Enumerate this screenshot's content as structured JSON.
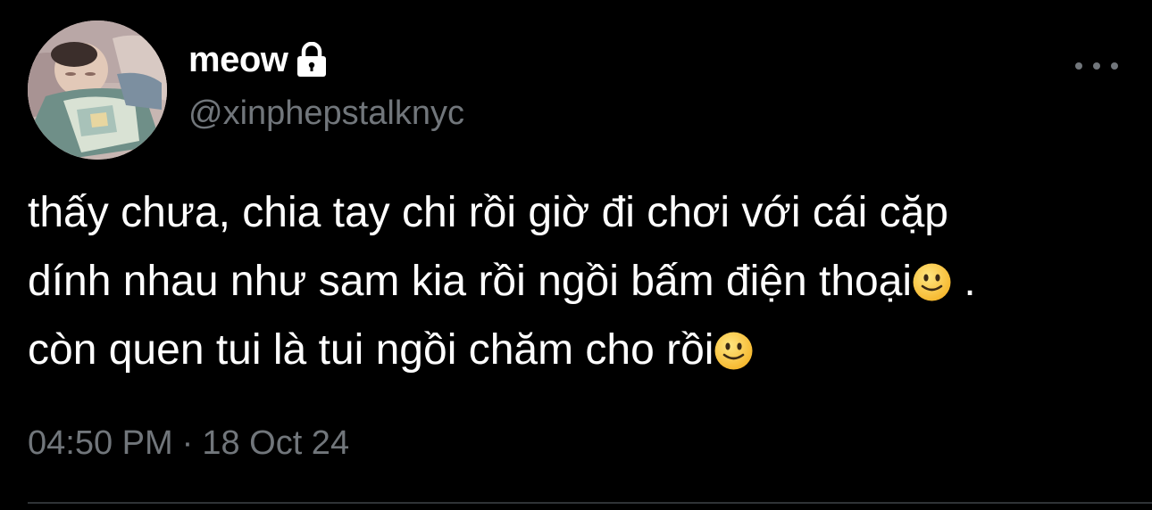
{
  "user": {
    "display_name": "meow",
    "handle": "@xinphepstalknyc",
    "protected_icon": "lock-icon",
    "avatar_icon": "sleeping-baby-avatar"
  },
  "tweet": {
    "lines": [
      "thấy chưa, chia tay chi rồi giờ đi chơi với cái cặp",
      "dính nhau như sam kia rồi ngồi bấm điện thoại",
      "còn quen tui là tui ngồi chăm cho rồi"
    ],
    "line2_suffix": " .",
    "emoji": "slightly-smiling-face"
  },
  "meta": {
    "time": "04:50 PM",
    "separator": "·",
    "date": "18 Oct 24"
  },
  "actions": {
    "more_icon": "more-horizontal-icon"
  },
  "colors": {
    "background": "#000000",
    "text_primary": "#ffffff",
    "text_secondary": "#71767b",
    "divider": "#2f3336"
  }
}
